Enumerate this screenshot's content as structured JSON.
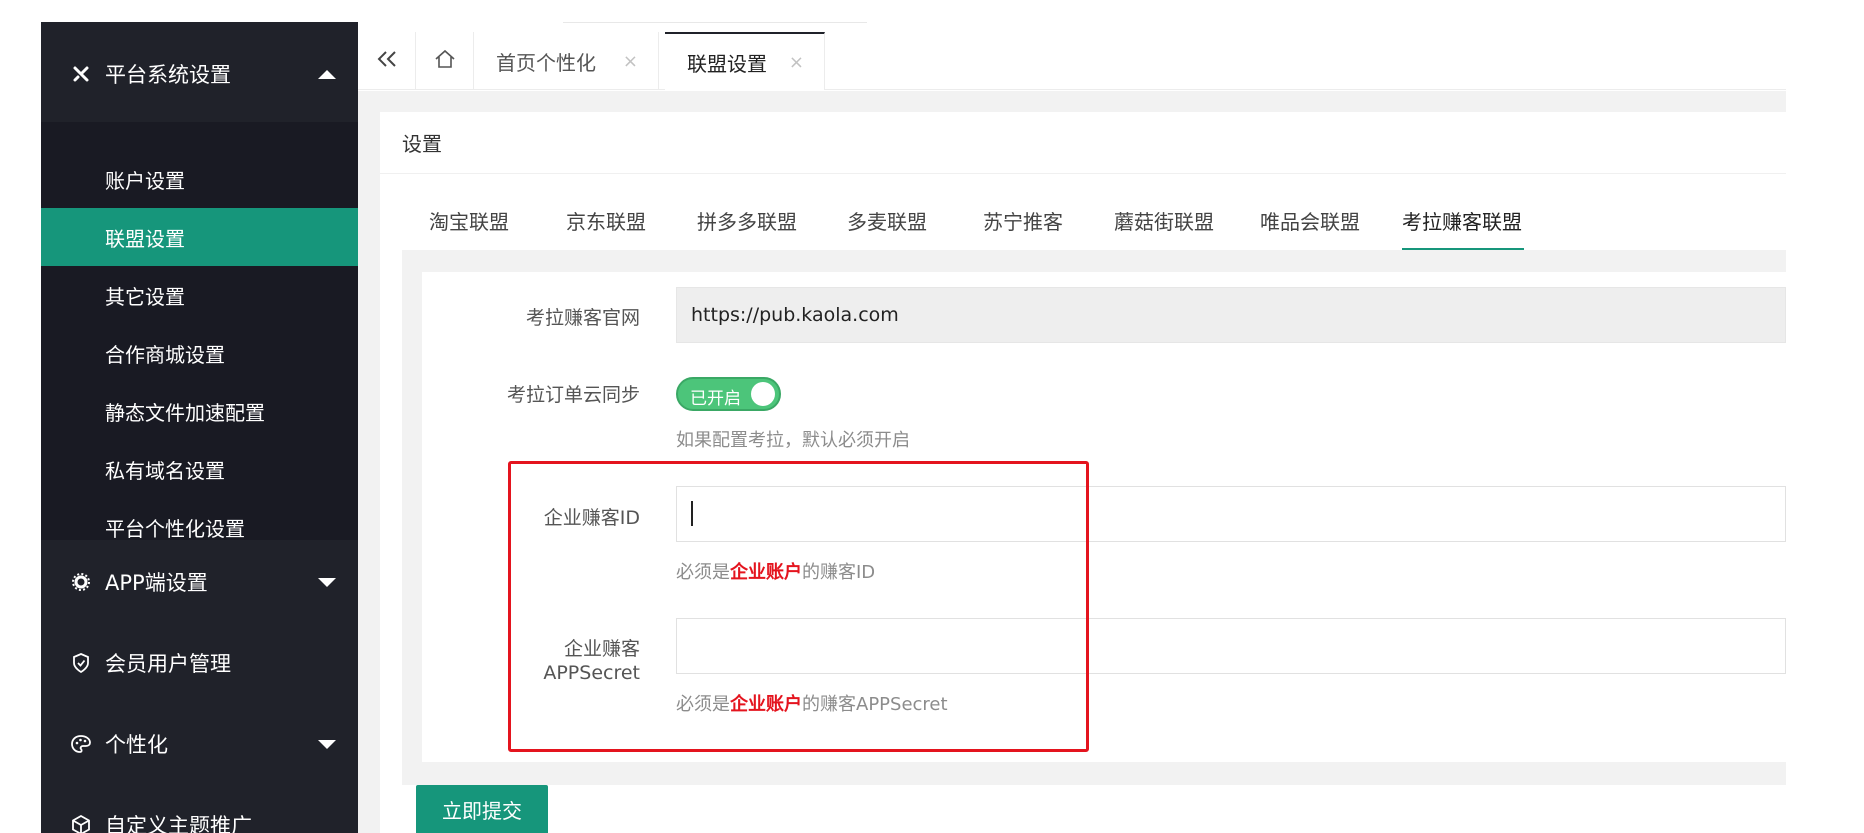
{
  "sidebar": {
    "groups": [
      {
        "label": "平台系统设置",
        "icon": "tools-icon",
        "expanded": true
      },
      {
        "label": "APP端设置",
        "icon": "gear-icon",
        "expanded": false
      },
      {
        "label": "会员用户管理",
        "icon": "shield-check-icon"
      },
      {
        "label": "个性化",
        "icon": "palette-icon",
        "expanded": false
      },
      {
        "label": "自定义主题推广",
        "icon": "cube-icon"
      }
    ],
    "items": [
      {
        "label": "账户设置"
      },
      {
        "label": "联盟设置",
        "active": true
      },
      {
        "label": "其它设置"
      },
      {
        "label": "合作商城设置"
      },
      {
        "label": "静态文件加速配置"
      },
      {
        "label": "私有域名设置"
      },
      {
        "label": "平台个性化设置"
      }
    ]
  },
  "topbar": {
    "collapse_icon": "double-chevron-left-icon",
    "home_icon": "home-icon",
    "tabs": [
      {
        "label": "首页个性化",
        "close": "×"
      },
      {
        "label": "联盟设置",
        "close": "×",
        "active": true
      }
    ]
  },
  "card": {
    "title": "设置"
  },
  "ally_tabs": [
    {
      "label": "淘宝联盟"
    },
    {
      "label": "京东联盟"
    },
    {
      "label": "拼多多联盟"
    },
    {
      "label": "多麦联盟"
    },
    {
      "label": "苏宁推客"
    },
    {
      "label": "蘑菇街联盟"
    },
    {
      "label": "唯品会联盟"
    },
    {
      "label": "考拉赚客联盟",
      "active": true
    }
  ],
  "form": {
    "site": {
      "label": "考拉赚客官网",
      "value": "https://pub.kaola.com"
    },
    "sync": {
      "label": "考拉订单云同步",
      "toggle_text": "已开启",
      "enabled": true,
      "hint": "如果配置考拉，默认必须开启"
    },
    "enterprise_id": {
      "label": "企业赚客ID",
      "value": "",
      "hint_prefix": "必须是",
      "hint_emphasis": "企业账户",
      "hint_suffix": "的赚客ID"
    },
    "app_secret": {
      "label_line1": "企业赚客",
      "label_line2": "APPSecret",
      "value": "",
      "hint_prefix": "必须是",
      "hint_emphasis": "企业账户",
      "hint_suffix": "的赚客APPSecret"
    }
  },
  "submit_label": "立即提交",
  "colors": {
    "sidebar_bg": "#20222a",
    "submenu_bg": "#191a23",
    "accent": "#16967b",
    "toggle_on": "#4cc57a",
    "highlight_red": "#e4141e"
  }
}
